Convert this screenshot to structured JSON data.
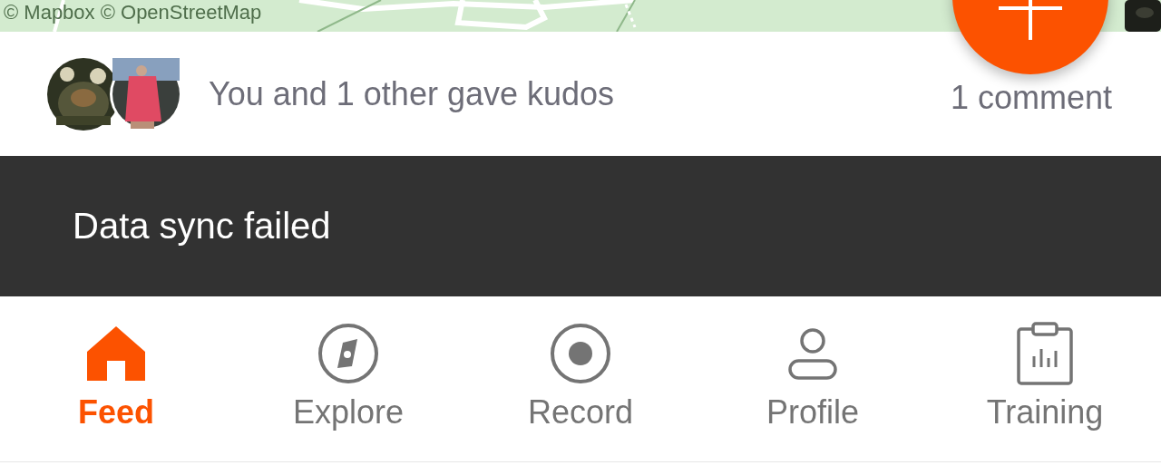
{
  "map": {
    "attribution": "© Mapbox © OpenStreetMap"
  },
  "kudos": {
    "text": "You and 1 other gave kudos",
    "comments": "1 comment"
  },
  "snackbar": {
    "message": "Data sync failed"
  },
  "nav": [
    {
      "label": "Feed",
      "kind": "home",
      "selected": true
    },
    {
      "label": "Explore",
      "kind": "compass",
      "selected": false
    },
    {
      "label": "Record",
      "kind": "record",
      "selected": false
    },
    {
      "label": "Profile",
      "kind": "person",
      "selected": false
    },
    {
      "label": "Training",
      "kind": "clipboard",
      "selected": false
    }
  ]
}
